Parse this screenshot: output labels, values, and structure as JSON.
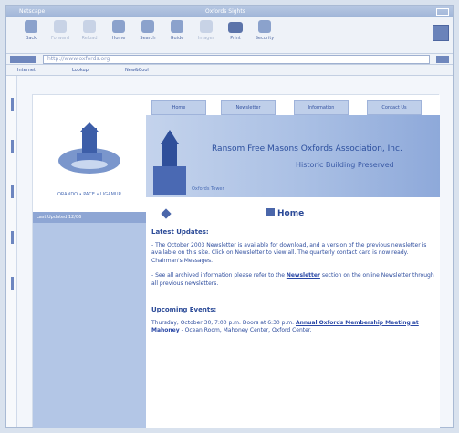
{
  "titlebar": {
    "app": "Netscape",
    "doc": "Oxfords Sights"
  },
  "toolbar": {
    "buttons": [
      {
        "label": "Back",
        "icon": "back-icon"
      },
      {
        "label": "Forward",
        "icon": "forward-icon"
      },
      {
        "label": "Reload",
        "icon": "reload-icon"
      },
      {
        "label": "Home",
        "icon": "home-icon"
      },
      {
        "label": "Search",
        "icon": "search-icon"
      },
      {
        "label": "Guide",
        "icon": "guide-icon"
      },
      {
        "label": "Images",
        "icon": "images-icon"
      },
      {
        "label": "Print",
        "icon": "print-icon"
      },
      {
        "label": "Security",
        "icon": "security-icon"
      }
    ]
  },
  "address": {
    "label": "Location:",
    "value": "http://www.oxfords.org"
  },
  "links": [
    "Internet",
    "Lookup",
    "New&Cool"
  ],
  "site": {
    "motto": "ORANDO • PACE • LIGAMUR",
    "sidebar_header": "Last Updated 12/06",
    "nav": [
      "Home",
      "Newsletter",
      "Information",
      "Contact Us"
    ],
    "banner_title": "Ransom Free Masons Oxfords Association, Inc.",
    "banner_sub": "Historic Building Preserved",
    "banner_caption": "Oxfords Tower",
    "content_tab": "Home",
    "section1_title": "Latest Updates:",
    "para1": "- The October 2003 Newsletter is available for download, and a version of the previous newsletter is available on this site. Click on Newsletter to view all. The quarterly contact card is now ready. Chairman's Messages.",
    "para2_text": "- See all archived information please refer to the ",
    "para2_link": "Newsletter",
    "para2_rest": " section on the online Newsletter through all previous newsletters.",
    "section2_title": "Upcoming Events:",
    "event_text": "Thursday, October 30, 7:00 p.m. Doors at 6:30 p.m. ",
    "event_link": "Annual Oxfords Membership Meeting at Mahoney",
    "event_rest": " - Ocean Room, Mahoney Center, Oxford Center."
  },
  "colors": {
    "accent": "#1f3f8a",
    "banner": "#a9bfe4",
    "sidebar": "#b3c6e6"
  }
}
